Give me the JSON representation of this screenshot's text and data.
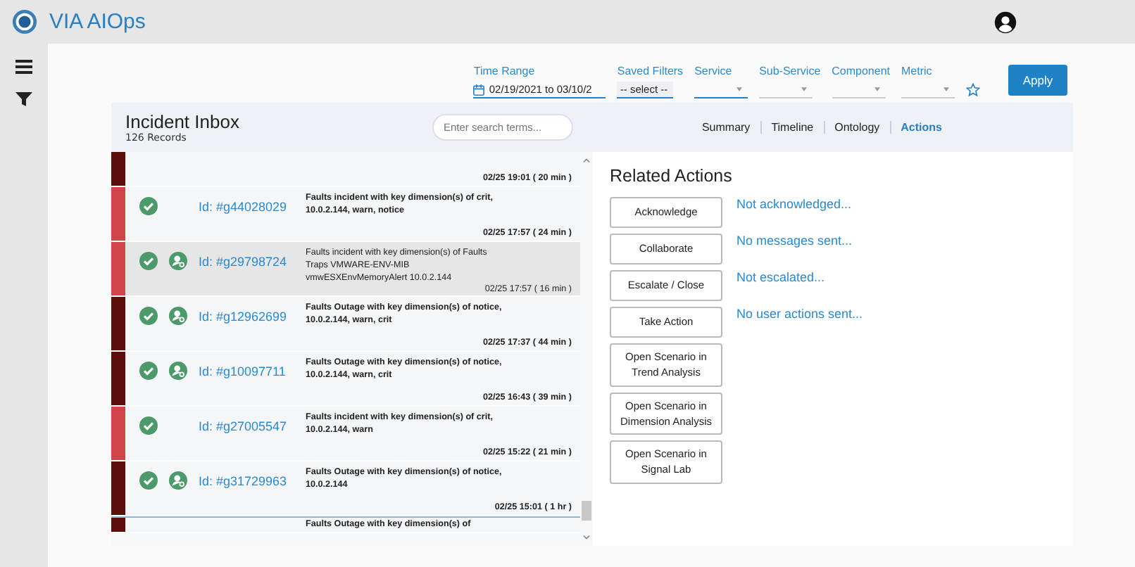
{
  "app": {
    "title": "VIA AIOps"
  },
  "filters": {
    "time_range": {
      "label": "Time Range",
      "value": "02/19/2021 to 03/10/2"
    },
    "saved_filters": {
      "label": "Saved Filters",
      "value": "-- select --"
    },
    "dropdowns": [
      {
        "label": "Service"
      },
      {
        "label": "Sub-Service"
      },
      {
        "label": "Component"
      },
      {
        "label": "Metric"
      }
    ],
    "apply_button": "Apply"
  },
  "inbox": {
    "title": "Incident Inbox",
    "count": "126 Records",
    "search": {
      "placeholder": "Enter search terms..."
    },
    "tabs": [
      {
        "label": "Summary",
        "selected": false
      },
      {
        "label": "Timeline",
        "selected": false
      },
      {
        "label": "Ontology",
        "selected": false
      },
      {
        "label": "Actions",
        "selected": true
      }
    ],
    "incidents": [
      {
        "kind": "partial",
        "color": "#5e0d0d",
        "time": "02/25 19:01 ( 20 min )"
      },
      {
        "kind": "full",
        "color": "#d2454a",
        "acknowledged": true,
        "collaborator": false,
        "id": "Id: #g44028029",
        "description": "Faults incident with key dimension(s) of crit, 10.0.2.144, warn, notice",
        "time": "02/25 17:57 ( 24 min )",
        "selected": false
      },
      {
        "kind": "full",
        "color": "#d2454a",
        "acknowledged": true,
        "collaborator": true,
        "id": "Id: #g29798724",
        "description": "Faults incident with key dimension(s) of Faults Traps VMWARE-ENV-MIB vmwESXEnvMemoryAlert 10.0.2.144",
        "time": "02/25 17:57 ( 16 min )",
        "selected": true
      },
      {
        "kind": "full",
        "color": "#5e0d0d",
        "acknowledged": true,
        "collaborator": true,
        "id": "Id: #g12962699",
        "description": "Faults Outage with key dimension(s) of notice, 10.0.2.144, warn, crit",
        "time": "02/25 17:37 ( 44 min )",
        "selected": false
      },
      {
        "kind": "full",
        "color": "#5e0d0d",
        "acknowledged": true,
        "collaborator": true,
        "id": "Id: #g10097711",
        "description": "Faults Outage with key dimension(s) of notice, 10.0.2.144, warn, crit",
        "time": "02/25 16:43 ( 39 min )",
        "selected": false
      },
      {
        "kind": "full",
        "color": "#d2454a",
        "acknowledged": true,
        "collaborator": false,
        "id": "Id: #g27005547",
        "description": "Faults incident with key dimension(s) of crit, 10.0.2.144, warn",
        "time": "02/25 15:22 ( 21 min )",
        "selected": false
      },
      {
        "kind": "full",
        "color": "#5e0d0d",
        "acknowledged": true,
        "collaborator": true,
        "id": "Id: #g31729963",
        "description": "Faults Outage with key dimension(s) of notice, 10.0.2.144",
        "time": "02/25 15:01 ( 1 hr )",
        "selected": false
      },
      {
        "kind": "cut",
        "color": "#5e0d0d",
        "description": "Faults Outage with key dimension(s) of"
      }
    ]
  },
  "related_actions": {
    "title": "Related Actions",
    "actions": [
      {
        "button": "Acknowledge",
        "status": "Not acknowledged..."
      },
      {
        "button": "Collaborate",
        "status": "No messages sent..."
      },
      {
        "button": "Escalate / Close",
        "status": "Not escalated..."
      },
      {
        "button": "Take Action",
        "status": "No user actions sent..."
      },
      {
        "button": "Open Scenario in Trend Analysis"
      },
      {
        "button": "Open Scenario in Dimension Analysis"
      },
      {
        "button": "Open Scenario in Signal Lab"
      }
    ]
  }
}
